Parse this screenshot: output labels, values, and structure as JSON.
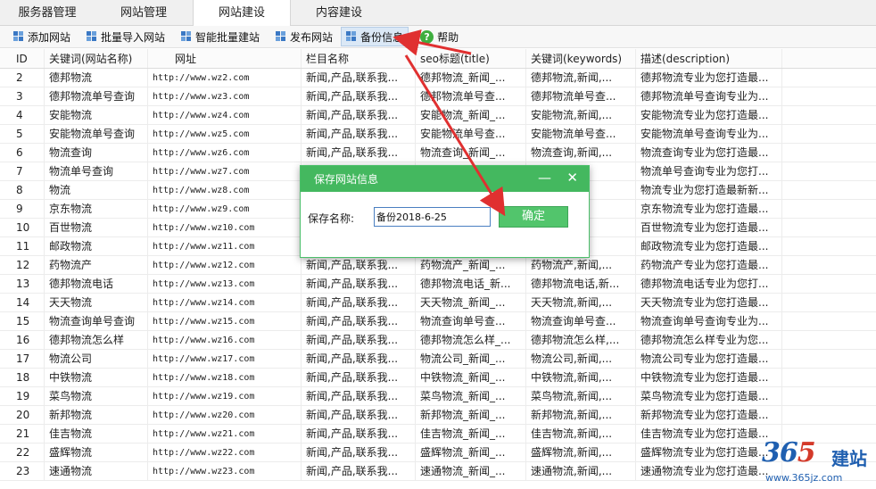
{
  "tabs": [
    {
      "label": "服务器管理"
    },
    {
      "label": "网站管理"
    },
    {
      "label": "网站建设"
    },
    {
      "label": "内容建设"
    }
  ],
  "toolbar": {
    "add_site": "添加网站",
    "batch_import": "批量导入网站",
    "smart_batch": "智能批量建站",
    "publish": "发布网站",
    "backup": "备份信息",
    "help": "帮助"
  },
  "table": {
    "headers": {
      "id": "ID",
      "keyword": "关键词(网站名称)",
      "url": "网址",
      "column": "栏目名称",
      "seo_title": "seo标题(title)",
      "keywords": "关键词(keywords)",
      "description": "描述(description)"
    },
    "rows": [
      {
        "id": "2",
        "kw": "德邦物流",
        "url": "http://www.wz2.com",
        "col": "新闻,产品,联系我...",
        "title": "德邦物流_新闻_...",
        "keys": "德邦物流,新闻,...",
        "desc": "德邦物流专业为您打造最..."
      },
      {
        "id": "3",
        "kw": "德邦物流单号查询",
        "url": "http://www.wz3.com",
        "col": "新闻,产品,联系我...",
        "title": "德邦物流单号查...",
        "keys": "德邦物流单号查...",
        "desc": "德邦物流单号查询专业为..."
      },
      {
        "id": "4",
        "kw": "安能物流",
        "url": "http://www.wz4.com",
        "col": "新闻,产品,联系我...",
        "title": "安能物流_新闻_...",
        "keys": "安能物流,新闻,...",
        "desc": "安能物流专业为您打造最..."
      },
      {
        "id": "5",
        "kw": "安能物流单号查询",
        "url": "http://www.wz5.com",
        "col": "新闻,产品,联系我...",
        "title": "安能物流单号查...",
        "keys": "安能物流单号查...",
        "desc": "安能物流单号查询专业为..."
      },
      {
        "id": "6",
        "kw": "物流查询",
        "url": "http://www.wz6.com",
        "col": "新闻,产品,联系我...",
        "title": "物流查询_新闻_...",
        "keys": "物流查询,新闻,...",
        "desc": "物流查询专业为您打造最..."
      },
      {
        "id": "7",
        "kw": "物流单号查询",
        "url": "http://www.wz7.com",
        "col": "",
        "title": "",
        "keys": "新...",
        "desc": "物流单号查询专业为您打..."
      },
      {
        "id": "8",
        "kw": "物流",
        "url": "http://www.wz8.com",
        "col": "",
        "title": "",
        "keys": "...",
        "desc": "物流专业为您打造最新新..."
      },
      {
        "id": "9",
        "kw": "京东物流",
        "url": "http://www.wz9.com",
        "col": "",
        "title": "",
        "keys": "",
        "desc": "京东物流专业为您打造最..."
      },
      {
        "id": "10",
        "kw": "百世物流",
        "url": "http://www.wz10.com",
        "col": "",
        "title": "",
        "keys": "",
        "desc": "百世物流专业为您打造最..."
      },
      {
        "id": "11",
        "kw": "邮政物流",
        "url": "http://www.wz11.com",
        "col": "",
        "title": "",
        "keys": "",
        "desc": "邮政物流专业为您打造最..."
      },
      {
        "id": "12",
        "kw": "药物流产",
        "url": "http://www.wz12.com",
        "col": "新闻,产品,联系我...",
        "title": "药物流产_新闻_...",
        "keys": "药物流产,新闻,...",
        "desc": "药物流产专业为您打造最..."
      },
      {
        "id": "13",
        "kw": "德邦物流电话",
        "url": "http://www.wz13.com",
        "col": "新闻,产品,联系我...",
        "title": "德邦物流电话_新...",
        "keys": "德邦物流电话,新...",
        "desc": "德邦物流电话专业为您打..."
      },
      {
        "id": "14",
        "kw": "天天物流",
        "url": "http://www.wz14.com",
        "col": "新闻,产品,联系我...",
        "title": "天天物流_新闻_...",
        "keys": "天天物流,新闻,...",
        "desc": "天天物流专业为您打造最..."
      },
      {
        "id": "15",
        "kw": "物流查询单号查询",
        "url": "http://www.wz15.com",
        "col": "新闻,产品,联系我...",
        "title": "物流查询单号查...",
        "keys": "物流查询单号查...",
        "desc": "物流查询单号查询专业为..."
      },
      {
        "id": "16",
        "kw": "德邦物流怎么样",
        "url": "http://www.wz16.com",
        "col": "新闻,产品,联系我...",
        "title": "德邦物流怎么样_...",
        "keys": "德邦物流怎么样,...",
        "desc": "德邦物流怎么样专业为您..."
      },
      {
        "id": "17",
        "kw": "物流公司",
        "url": "http://www.wz17.com",
        "col": "新闻,产品,联系我...",
        "title": "物流公司_新闻_...",
        "keys": "物流公司,新闻,...",
        "desc": "物流公司专业为您打造最..."
      },
      {
        "id": "18",
        "kw": "中铁物流",
        "url": "http://www.wz18.com",
        "col": "新闻,产品,联系我...",
        "title": "中铁物流_新闻_...",
        "keys": "中铁物流,新闻,...",
        "desc": "中铁物流专业为您打造最..."
      },
      {
        "id": "19",
        "kw": "菜鸟物流",
        "url": "http://www.wz19.com",
        "col": "新闻,产品,联系我...",
        "title": "菜鸟物流_新闻_...",
        "keys": "菜鸟物流,新闻,...",
        "desc": "菜鸟物流专业为您打造最..."
      },
      {
        "id": "20",
        "kw": "新邦物流",
        "url": "http://www.wz20.com",
        "col": "新闻,产品,联系我...",
        "title": "新邦物流_新闻_...",
        "keys": "新邦物流,新闻,...",
        "desc": "新邦物流专业为您打造最..."
      },
      {
        "id": "21",
        "kw": "佳吉物流",
        "url": "http://www.wz21.com",
        "col": "新闻,产品,联系我...",
        "title": "佳吉物流_新闻_...",
        "keys": "佳吉物流,新闻,...",
        "desc": "佳吉物流专业为您打造最..."
      },
      {
        "id": "22",
        "kw": "盛辉物流",
        "url": "http://www.wz22.com",
        "col": "新闻,产品,联系我...",
        "title": "盛辉物流_新闻_...",
        "keys": "盛辉物流,新闻,...",
        "desc": "盛辉物流专业为您打造最..."
      },
      {
        "id": "23",
        "kw": "速通物流",
        "url": "http://www.wz23.com",
        "col": "新闻,产品,联系我...",
        "title": "速通物流_新闻_...",
        "keys": "速通物流,新闻,...",
        "desc": "速通物流专业为您打造最..."
      }
    ]
  },
  "dialog": {
    "title": "保存网站信息",
    "minimize": "—",
    "close": "✕",
    "name_label": "保存名称:",
    "name_value": "备份2018-6-25",
    "ok": "确定"
  },
  "watermark": {
    "num_a": "36",
    "num_b": "5",
    "text": "建站",
    "url": "www.365jz.com"
  },
  "colors": {
    "accent_green": "#44b85f",
    "arrow_red": "#e03030",
    "brand_blue": "#1f5fb0"
  }
}
